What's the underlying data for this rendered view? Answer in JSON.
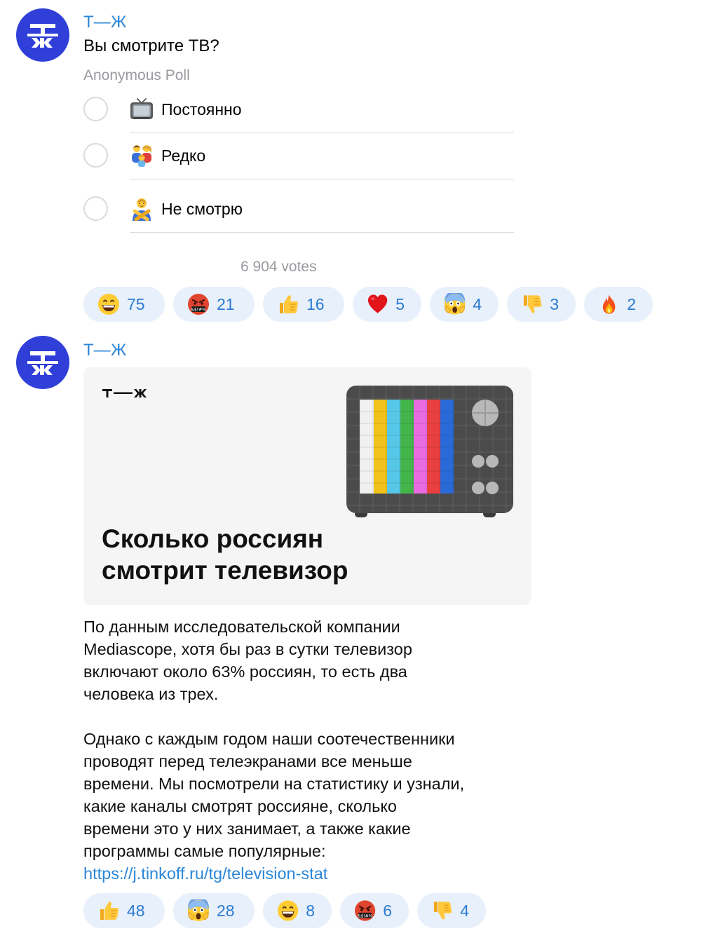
{
  "messages": [
    {
      "author": "Т—Ж",
      "avatar_text": "ТЖ",
      "poll": {
        "question": "Вы смотрите ТВ?",
        "type": "Anonymous Poll",
        "options": [
          {
            "emoji": "tv-icon",
            "label": "Постоянно"
          },
          {
            "emoji": "family-icon",
            "label": "Редко"
          },
          {
            "emoji": "person-gesturing-no-icon",
            "label": "Не смотрю"
          }
        ],
        "votes": "6 904 votes"
      },
      "reactions": [
        {
          "emoji": "grinning-face-icon",
          "count": "75"
        },
        {
          "emoji": "cursing-face-icon",
          "count": "21"
        },
        {
          "emoji": "thumbs-up-icon",
          "count": "16"
        },
        {
          "emoji": "red-heart-icon",
          "count": "5"
        },
        {
          "emoji": "screaming-face-icon",
          "count": "4"
        },
        {
          "emoji": "thumbs-down-icon",
          "count": "3"
        },
        {
          "emoji": "fire-icon",
          "count": "2"
        }
      ]
    },
    {
      "author": "Т—Ж",
      "avatar_text": "ТЖ",
      "card": {
        "logo_text": "т—ж",
        "title_lines": [
          "Сколько россиян",
          "смотрит телевизор"
        ]
      },
      "text": {
        "para1": [
          "По данным исследовательской компании",
          "Mediascope, хотя бы раз в сутки телевизор",
          "включают около 63% россиян, то есть два",
          "человека из трех."
        ],
        "para2": [
          "Однако с каждым годом наши соотечественники",
          "проводят перед телеэкранами все меньше",
          "времени. Мы посмотрели на статистику и узнали,",
          "какие каналы смотрят россияне, сколько",
          "времени это у них занимает, а также какие",
          "программы самые популярные:"
        ],
        "link": "https://j.tinkoff.ru/tg/television-stat"
      },
      "reactions": [
        {
          "emoji": "thumbs-up-icon",
          "count": "48"
        },
        {
          "emoji": "screaming-face-icon",
          "count": "28"
        },
        {
          "emoji": "grinning-face-icon",
          "count": "8"
        },
        {
          "emoji": "cursing-face-icon",
          "count": "6"
        },
        {
          "emoji": "thumbs-down-icon",
          "count": "4"
        }
      ]
    }
  ],
  "colors": {
    "avatar_bg": "#2f3fd8",
    "link": "#2a86d8",
    "reaction_bg": "#e8f0fb",
    "reaction_count": "#2a7bd0",
    "muted": "#9a9aa0",
    "card_bg": "#f5f5f6"
  }
}
